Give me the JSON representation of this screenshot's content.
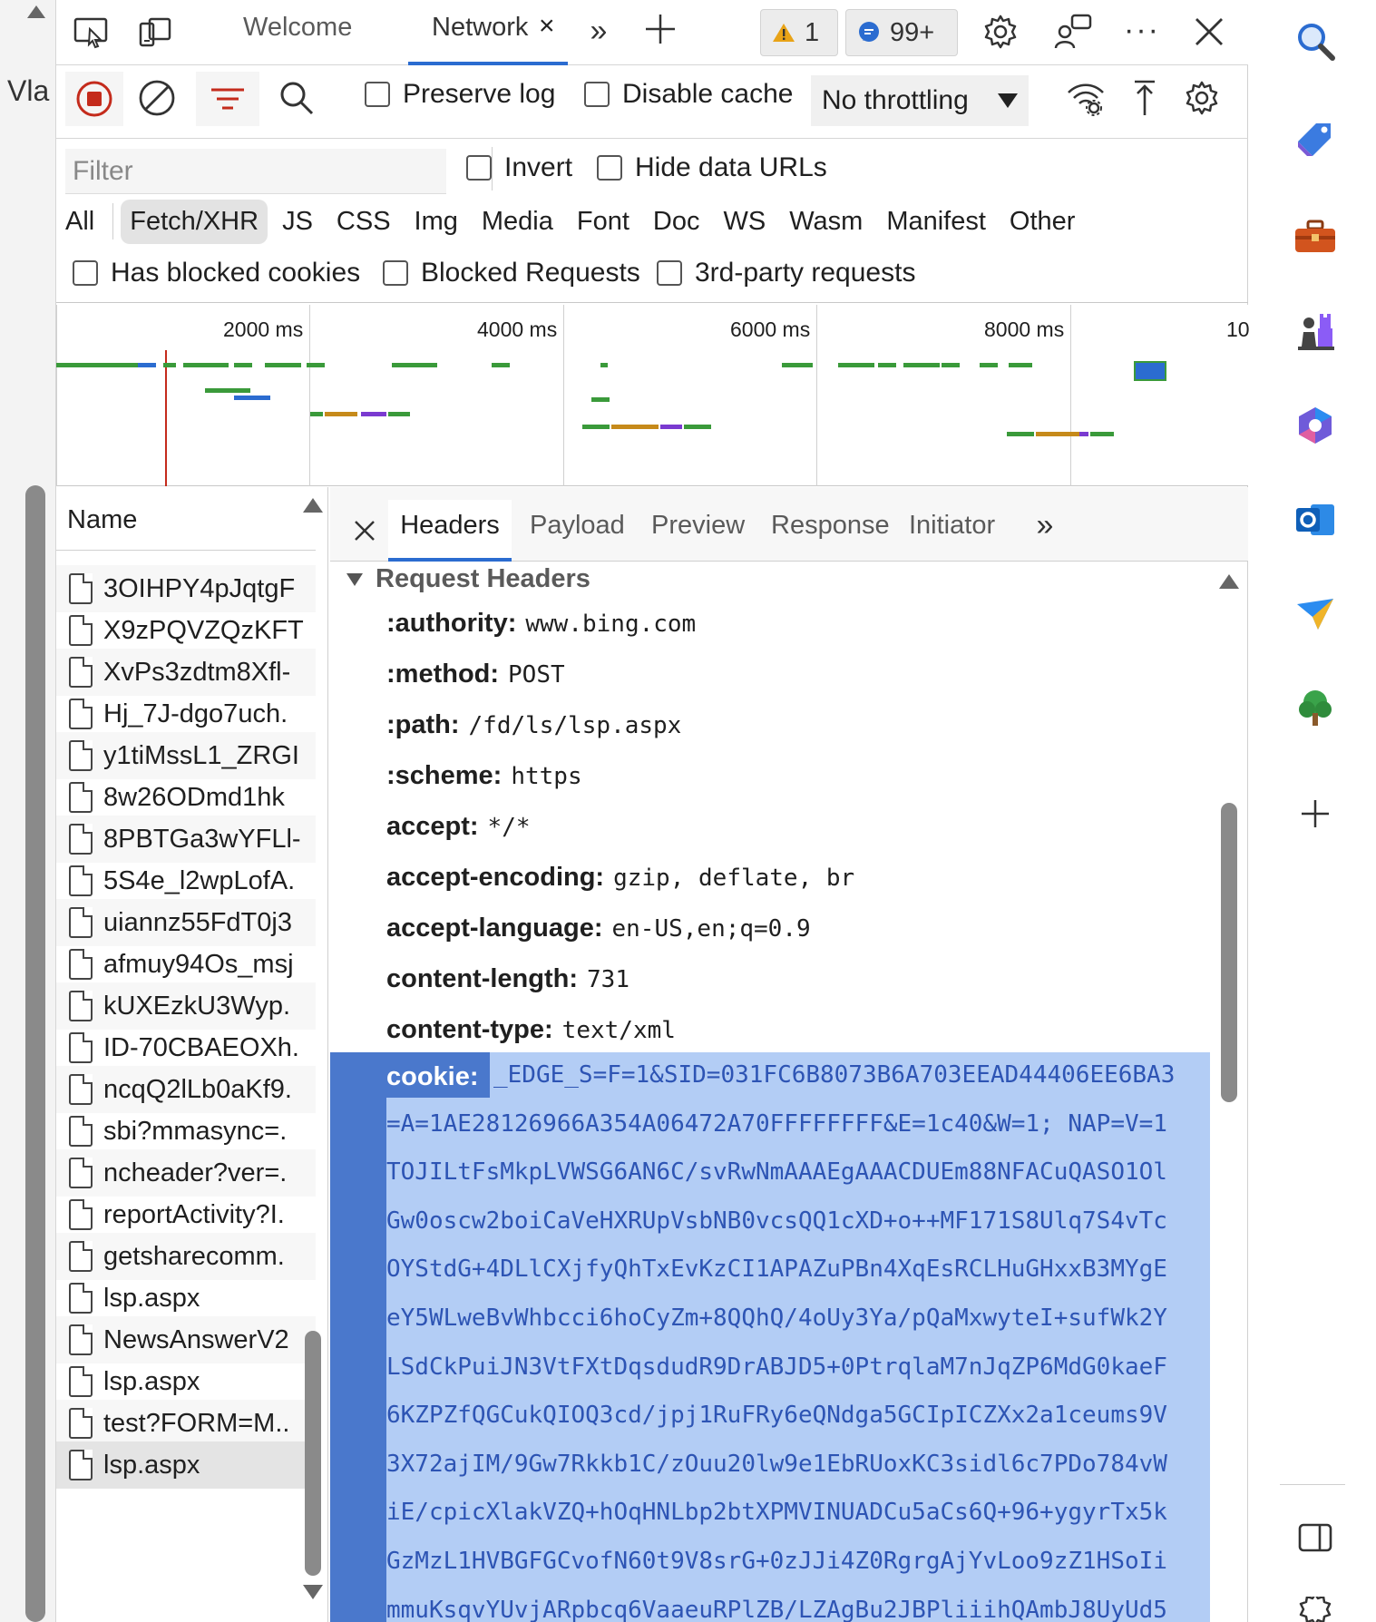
{
  "left_gutter": {
    "partial_text": "Vla"
  },
  "toolbar": {
    "tabs": [
      {
        "label": "Welcome"
      },
      {
        "label": "Network"
      }
    ],
    "warnings_count": "1",
    "messages_count": "99+"
  },
  "network_toolbar": {
    "preserve_log": "Preserve log",
    "disable_cache": "Disable cache",
    "throttling": "No throttling"
  },
  "filter": {
    "placeholder": "Filter",
    "invert": "Invert",
    "hide_data_urls": "Hide data URLs",
    "types": [
      "All",
      "Fetch/XHR",
      "JS",
      "CSS",
      "Img",
      "Media",
      "Font",
      "Doc",
      "WS",
      "Wasm",
      "Manifest",
      "Other"
    ],
    "selected_type": "Fetch/XHR",
    "has_blocked_cookies": "Has blocked cookies",
    "blocked_requests": "Blocked Requests",
    "third_party": "3rd-party requests"
  },
  "timeline": {
    "labels": [
      "2000 ms",
      "4000 ms",
      "6000 ms",
      "8000 ms",
      "10"
    ]
  },
  "name_column": {
    "header": "Name",
    "items": [
      "3OIHPY4pJqtgF",
      "X9zPQVZQzKFT",
      "XvPs3zdtm8Xfl-",
      "Hj_7J-dgo7uch.",
      "y1tiMssL1_ZRGI",
      "8w26ODmd1hk",
      "8PBTGa3wYFLl-",
      "5S4e_l2wpLofA.",
      "uiannz55FdT0j3",
      "afmuy94Os_msj",
      "kUXEzkU3Wyp.",
      "ID-70CBAEOXh.",
      "ncqQ2lLb0aKf9.",
      "sbi?mmasync=.",
      "ncheader?ver=.",
      "reportActivity?I.",
      "getsharecomm.",
      "lsp.aspx",
      "NewsAnswerV2",
      "lsp.aspx",
      "test?FORM=M..",
      "lsp.aspx"
    ]
  },
  "detail": {
    "tabs": [
      "Headers",
      "Payload",
      "Preview",
      "Response",
      "Initiator"
    ],
    "section_title": "Request Headers",
    "headers": [
      {
        "key": ":authority:",
        "value": "www.bing.com"
      },
      {
        "key": ":method:",
        "value": "POST"
      },
      {
        "key": ":path:",
        "value": "/fd/ls/lsp.aspx"
      },
      {
        "key": ":scheme:",
        "value": "https"
      },
      {
        "key": "accept:",
        "value": "*/*"
      },
      {
        "key": "accept-encoding:",
        "value": "gzip, deflate, br"
      },
      {
        "key": "accept-language:",
        "value": "en-US,en;q=0.9"
      },
      {
        "key": "content-length:",
        "value": "731"
      },
      {
        "key": "content-type:",
        "value": "text/xml"
      }
    ],
    "cookie_key": "cookie:",
    "cookie_lines": [
      "_EDGE_S=F=1&SID=031FC6B8073B6A703EEAD44406EE6BA3",
      "=A=1AE28126966A354A06472A70FFFFFFFF&E=1c40&W=1; NAP=V=1",
      "TOJILtFsMkpLVWSG6AN6C/svRwNmAAAEgAAACDUEm88NFACuQASO1Ol",
      "Gw0oscw2boiCaVeHXRUpVsbNB0vcsQQ1cXD+o++MF171S8Ulq7S4vTc",
      "OYStdG+4DLlCXjfyQhTxEvKzCI1APAZuPBn4XqEsRCLHuGHxxB3MYgE",
      "eY5WLweBvWhbcci6hoCyZm+8QQhQ/4oUy3Ya/pQaMxwyteI+sufWk2Y",
      "LSdCkPuiJN3VtFXtDqsdudR9DrABJD5+0PtrqlaM7nJqZP6MdG0kaeF",
      "6KZPZfQGCukQIOQ3cd/jpj1RuFRy6eQNdga5GCIpICZXx2a1ceums9V",
      "3X72ajIM/9Gw7Rkkb1C/zOuu20lw9e1EbRUoxKC3sidl6c7PDo784vW",
      "iE/cpicXlakVZQ+hOqHNLbp2btXPMVINUADCu5aCs6Q+96+ygyrTx5k",
      "GzMzL1HVBGFGCvofN60t9V8srG+0zJJi4Z0RgrgAjYvLoo9zZ1HSoIi",
      "mmuKsqvYUvjARpbcq6VaaeuRPlZB/LZAgBu2JBPliiihQAmbJ8UyUd5"
    ]
  },
  "colors": {
    "accent": "#2b6cd0",
    "record_red": "#c42b1c",
    "selection_dark": "#4a78cc",
    "selection_light": "#b3cdf5",
    "selection_text": "#2d54b4"
  },
  "sidebar_icons": [
    "search-icon",
    "tag-icon",
    "toolbox-icon",
    "chess-icon",
    "copilot-icon",
    "outlook-icon",
    "send-icon",
    "tree-icon",
    "add-icon",
    "split-view-icon",
    "settings-icon"
  ]
}
